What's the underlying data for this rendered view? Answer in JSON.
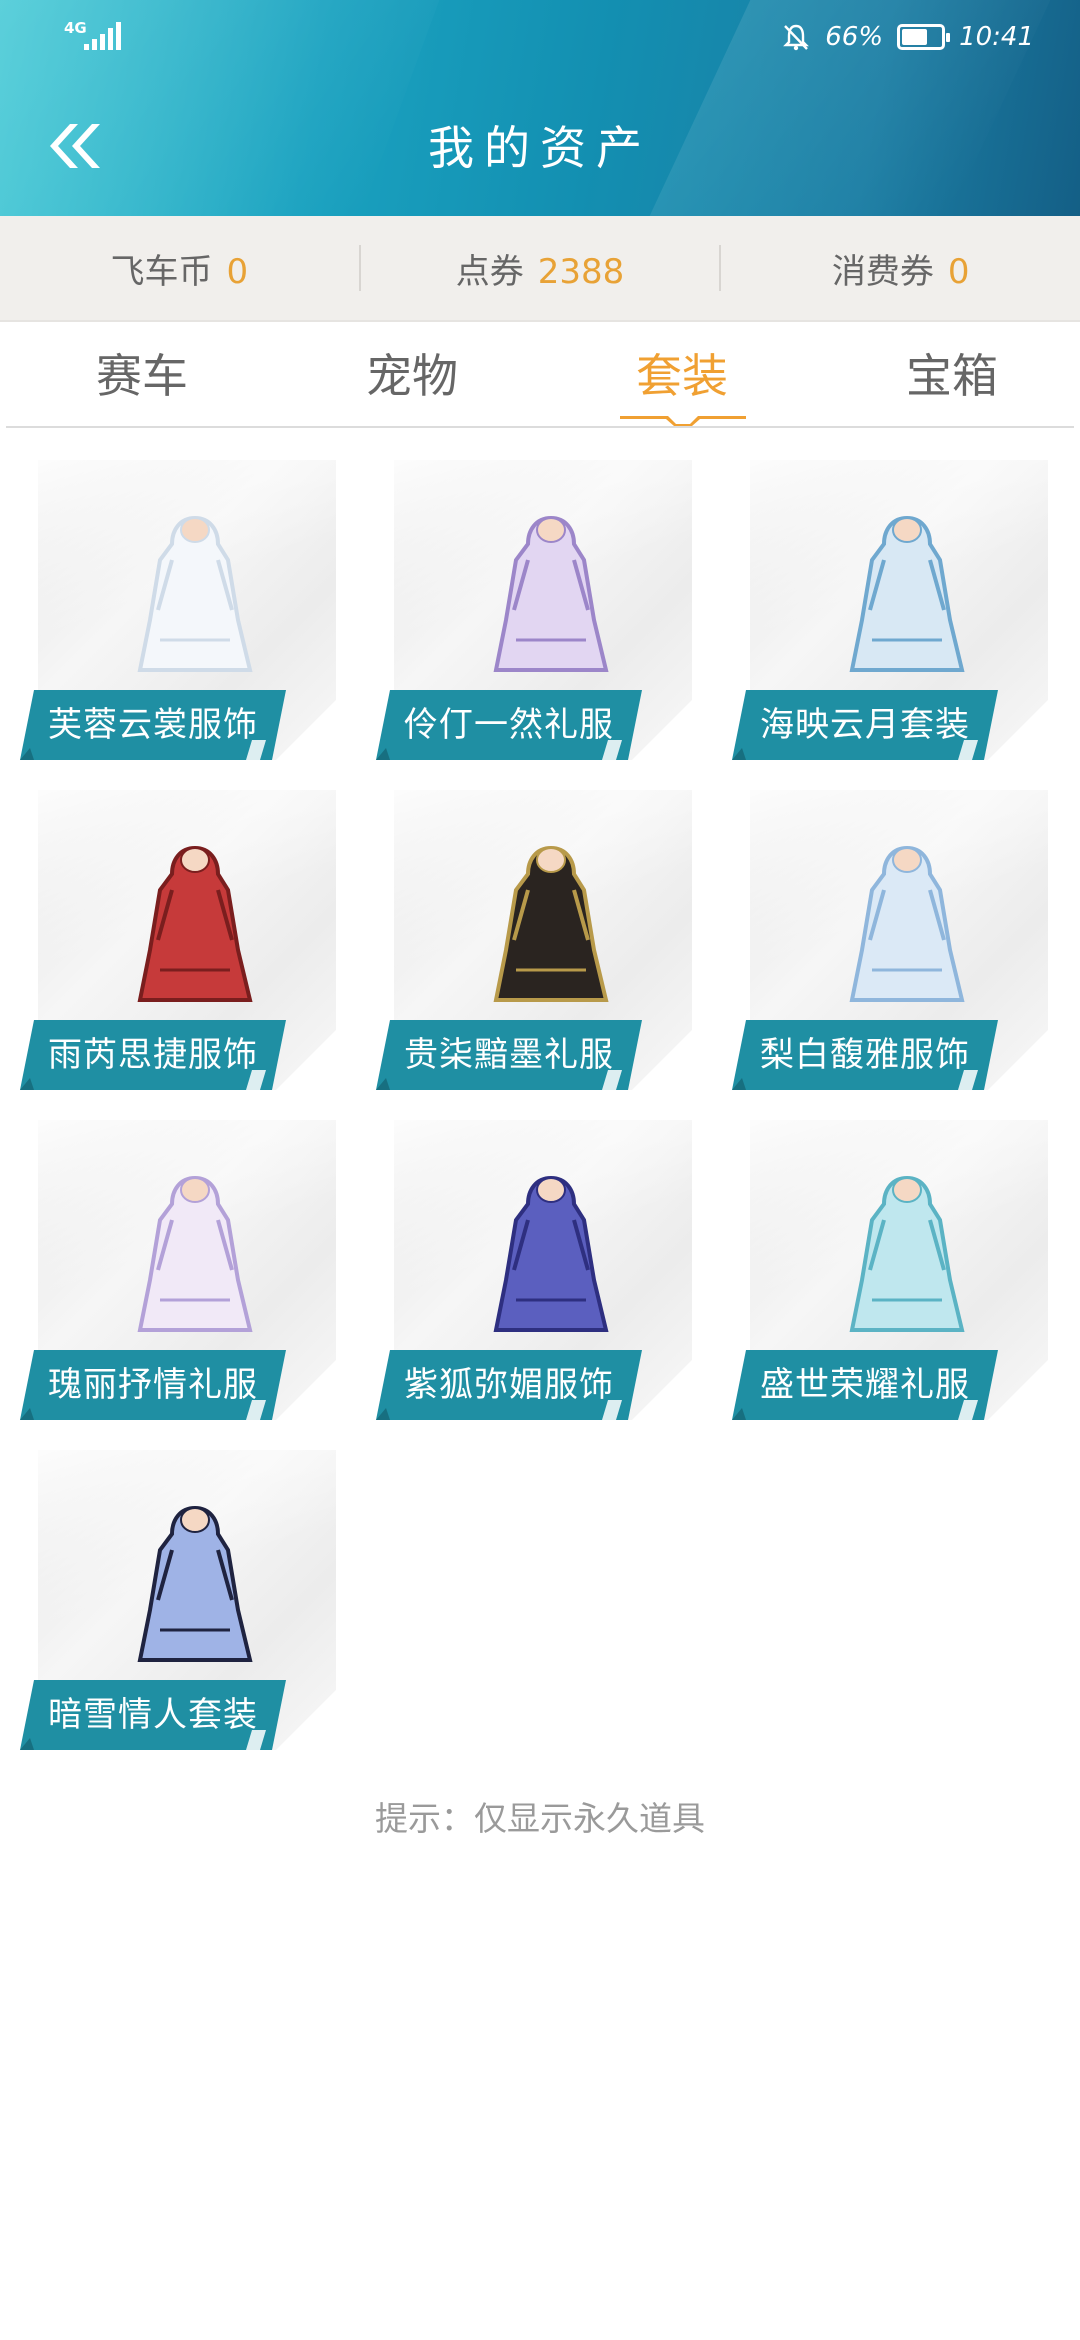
{
  "status_bar": {
    "network": "4G",
    "battery": "66%",
    "time": "10:41",
    "battery_level": 0.66
  },
  "header": {
    "title": "我的资产",
    "back_icon": "double-chevron-left-icon"
  },
  "currency": [
    {
      "label": "飞车币",
      "value": "0"
    },
    {
      "label": "点券",
      "value": "2388"
    },
    {
      "label": "消费券",
      "value": "0"
    }
  ],
  "tabs": [
    {
      "label": "赛车",
      "active": false
    },
    {
      "label": "宠物",
      "active": false
    },
    {
      "label": "套装",
      "active": true
    },
    {
      "label": "宝箱",
      "active": false
    }
  ],
  "items": [
    {
      "name": "芙蓉云裳服饰",
      "art": "white-outfit-icon"
    },
    {
      "name": "伶仃一然礼服",
      "art": "lavender-dress-icon"
    },
    {
      "name": "海映云月套装",
      "art": "character-blue-robe-icon"
    },
    {
      "name": "雨芮思捷服饰",
      "art": "red-plaid-dress-icon"
    },
    {
      "name": "贵柒黯墨礼服",
      "art": "black-gold-dress-icon"
    },
    {
      "name": "梨白馥雅服饰",
      "art": "light-blue-dress-icon"
    },
    {
      "name": "瑰丽抒情礼服",
      "art": "white-lavender-dress-icon"
    },
    {
      "name": "紫狐弥媚服饰",
      "art": "purple-gown-icon"
    },
    {
      "name": "盛世荣耀礼服",
      "art": "aqua-outfit-icon"
    },
    {
      "name": "暗雪情人套装",
      "art": "character-blue-hair-icon"
    }
  ],
  "hint": "提示：仅显示永久道具",
  "colors": {
    "accent": "#f0a032",
    "label_bg": "#1f8fa3",
    "header_start": "#3ec7d4",
    "header_end": "#145f86"
  }
}
